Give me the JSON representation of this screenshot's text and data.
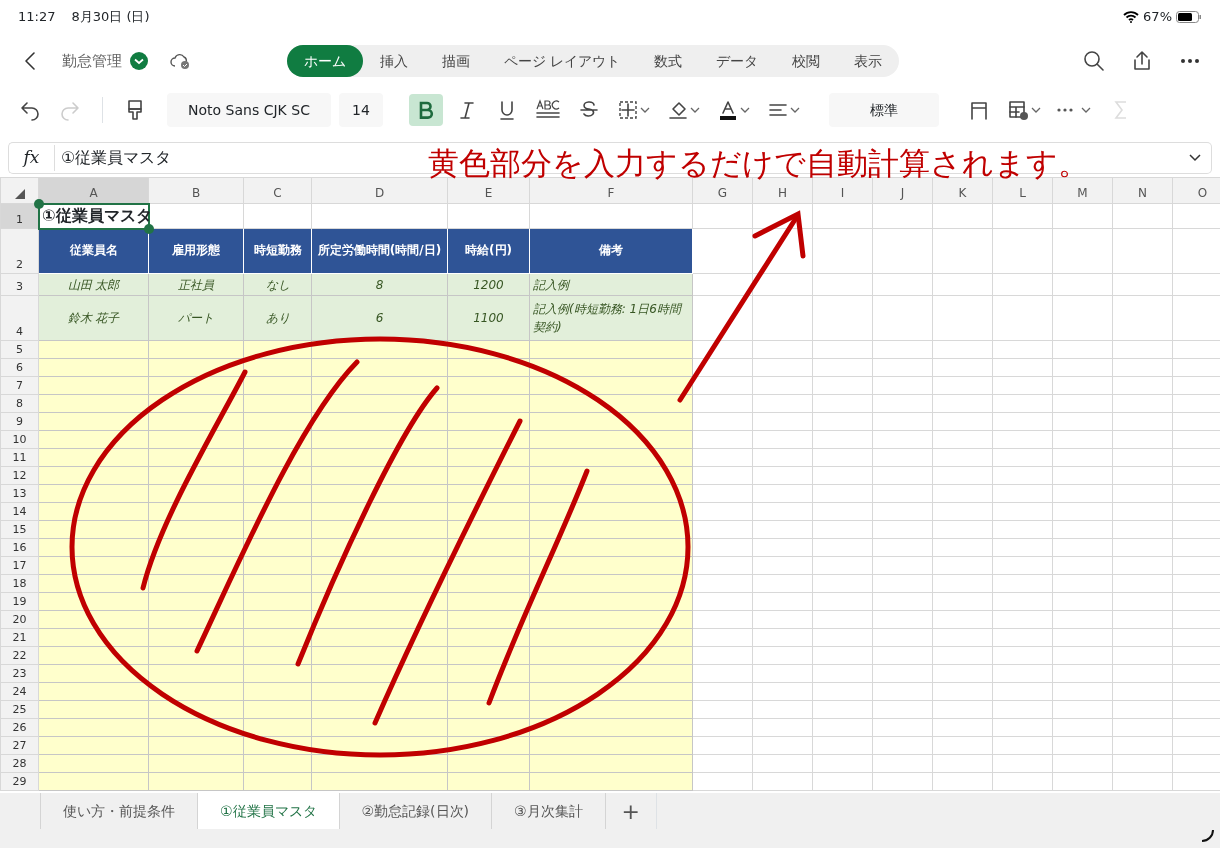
{
  "status_bar": {
    "time": "11:27",
    "date": "8月30日 (日)",
    "battery": "67%"
  },
  "document": {
    "title": "勤怠管理",
    "saved": true
  },
  "ribbon_tabs": [
    {
      "label": "ホーム",
      "selected": true
    },
    {
      "label": "挿入",
      "selected": false
    },
    {
      "label": "描画",
      "selected": false
    },
    {
      "label": "ページ レイアウト",
      "selected": false
    },
    {
      "label": "数式",
      "selected": false
    },
    {
      "label": "データ",
      "selected": false
    },
    {
      "label": "校閲",
      "selected": false
    },
    {
      "label": "表示",
      "selected": false
    }
  ],
  "toolbar": {
    "font": "Noto Sans CJK SC",
    "font_size": "14",
    "bold": true,
    "italic": false,
    "underline": false,
    "number_format": "標準"
  },
  "formula_bar": {
    "label": "fx",
    "value": "①従業員マスタ"
  },
  "columns": [
    "A",
    "B",
    "C",
    "D",
    "E",
    "F",
    "G",
    "H",
    "I",
    "J",
    "K",
    "L",
    "M",
    "N",
    "O"
  ],
  "sheet": {
    "title": "①従業員マスタ",
    "headers": [
      "従業員名",
      "雇用形態",
      "時短勤務",
      "所定労働時間(時間/日)",
      "時給(円)",
      "備考"
    ],
    "rows": [
      {
        "number": "1",
        "kind": "title",
        "cells": []
      },
      {
        "number": "2",
        "kind": "header",
        "cells": []
      },
      {
        "number": "3",
        "kind": "example",
        "cells": [
          "山田 太郎",
          "正社員",
          "なし",
          "8",
          "1200",
          "記入例"
        ]
      },
      {
        "number": "4",
        "kind": "example",
        "cells": [
          "鈴木 花子",
          "パート",
          "あり",
          "6",
          "1100",
          "記入例(時短勤務: 1日6時間契約)"
        ]
      },
      {
        "number": "5",
        "kind": "input",
        "cells": []
      },
      {
        "number": "6",
        "kind": "input",
        "cells": []
      },
      {
        "number": "7",
        "kind": "input",
        "cells": []
      },
      {
        "number": "8",
        "kind": "input",
        "cells": []
      },
      {
        "number": "9",
        "kind": "input",
        "cells": []
      },
      {
        "number": "10",
        "kind": "input",
        "cells": []
      },
      {
        "number": "11",
        "kind": "input",
        "cells": []
      },
      {
        "number": "12",
        "kind": "input",
        "cells": []
      },
      {
        "number": "13",
        "kind": "input",
        "cells": []
      },
      {
        "number": "14",
        "kind": "input",
        "cells": []
      },
      {
        "number": "15",
        "kind": "input",
        "cells": []
      },
      {
        "number": "16",
        "kind": "input",
        "cells": []
      },
      {
        "number": "17",
        "kind": "input",
        "cells": []
      },
      {
        "number": "18",
        "kind": "input",
        "cells": []
      },
      {
        "number": "19",
        "kind": "input",
        "cells": []
      },
      {
        "number": "20",
        "kind": "input",
        "cells": []
      },
      {
        "number": "21",
        "kind": "input",
        "cells": []
      },
      {
        "number": "22",
        "kind": "input",
        "cells": []
      },
      {
        "number": "23",
        "kind": "input",
        "cells": []
      },
      {
        "number": "24",
        "kind": "input",
        "cells": []
      },
      {
        "number": "25",
        "kind": "input",
        "cells": []
      },
      {
        "number": "26",
        "kind": "input",
        "cells": []
      },
      {
        "number": "27",
        "kind": "input",
        "cells": []
      },
      {
        "number": "28",
        "kind": "input",
        "cells": []
      },
      {
        "number": "29",
        "kind": "input",
        "cells": []
      }
    ]
  },
  "annotation": {
    "text": "黄色部分を入力するだけで自動計算されます。"
  },
  "sheet_tabs": [
    {
      "label": "使い方・前提条件",
      "selected": false
    },
    {
      "label": "①従業員マスタ",
      "selected": true
    },
    {
      "label": "②勤怠記録(日次)",
      "selected": false
    },
    {
      "label": "③月次集計",
      "selected": false
    }
  ],
  "add_sheet": "+"
}
